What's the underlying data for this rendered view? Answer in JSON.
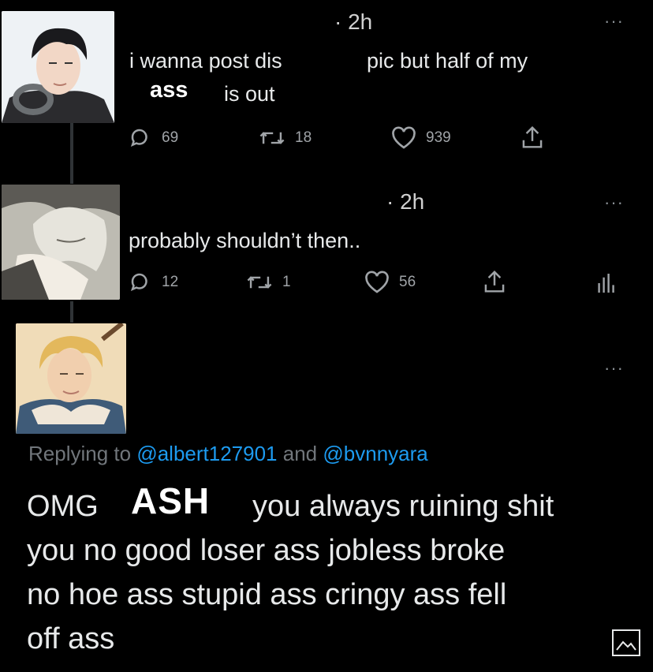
{
  "tweet1": {
    "time": "· 2h",
    "more": "···",
    "text_part1": "i wanna post dis",
    "text_part2": "pic but half of my",
    "overlay_word": "ass",
    "text_part3": "is out",
    "replies": "69",
    "retweets": "18",
    "likes": "939"
  },
  "tweet2": {
    "time": "· 2h",
    "more": "···",
    "text": "probably shouldn’t then..",
    "replies": "12",
    "retweets": "1",
    "likes": "56"
  },
  "tweet3": {
    "more": "···",
    "replying_prefix": "Replying to",
    "handle1": "@albert127901",
    "conjunction": "and",
    "handle2": "@bvnnyara",
    "line1_start": "OMG",
    "overlay_name": "ASH",
    "line1_end": "you always ruining shit",
    "line2": "you no good loser ass jobless broke",
    "line3": "no hoe ass stupid ass cringy ass fell",
    "line4": "off ass"
  },
  "colors": {
    "background": "#000000",
    "text": "#e7e9ea",
    "muted": "#71767b",
    "link": "#1d9bf0"
  },
  "icons": [
    "reply-icon",
    "retweet-icon",
    "like-icon",
    "share-icon",
    "analytics-icon",
    "image-icon",
    "more-icon"
  ]
}
